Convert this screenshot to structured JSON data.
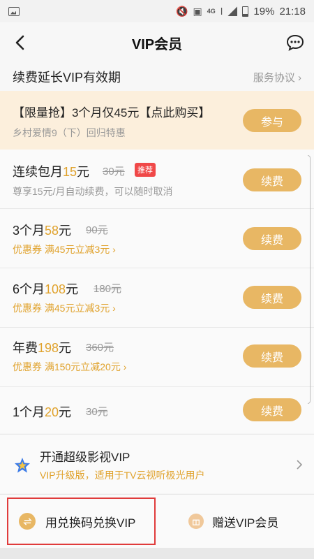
{
  "status": {
    "network": "4G",
    "battery": "19%",
    "time": "21:18"
  },
  "nav": {
    "title": "VIP会员"
  },
  "renew": {
    "title": "续费延长VIP有效期",
    "link": "服务协议"
  },
  "promo": {
    "line1": "【限量抢】3个月仅45元【点此购买】",
    "line2": "乡村爱情9（下）回归特惠",
    "button": "参与"
  },
  "plans": [
    {
      "name_pre": "连续包月",
      "price": "15",
      "name_post": "元",
      "orig": "30元",
      "badge": "推荐",
      "sub": "尊享15元/月自动续费，可以随时取消",
      "button": "续费"
    },
    {
      "name_pre": "3个月",
      "price": "58",
      "name_post": "元",
      "orig": "90元",
      "sub": "优惠券 满45元立减3元",
      "button": "续费"
    },
    {
      "name_pre": "6个月",
      "price": "108",
      "name_post": "元",
      "orig": "180元",
      "sub": "优惠券 满45元立减3元",
      "button": "续费"
    },
    {
      "name_pre": "年费",
      "price": "198",
      "name_post": "元",
      "orig": "360元",
      "sub": "优惠券 满150元立减20元",
      "button": "续费"
    },
    {
      "name_pre": "1个月",
      "price": "20",
      "name_post": "元",
      "orig": "30元",
      "button": "续费"
    }
  ],
  "super_vip": {
    "title": "开通超级影视VIP",
    "subtitle": "VIP升级版，适用于TV云视听极光用户"
  },
  "bottom": {
    "redeem": "用兑换码兑换VIP",
    "gift": "赠送VIP会员"
  },
  "colors": {
    "accent": "#e8b764",
    "price": "#e0a22c",
    "badge": "#f04848",
    "promo_bg": "#fcefdc"
  }
}
